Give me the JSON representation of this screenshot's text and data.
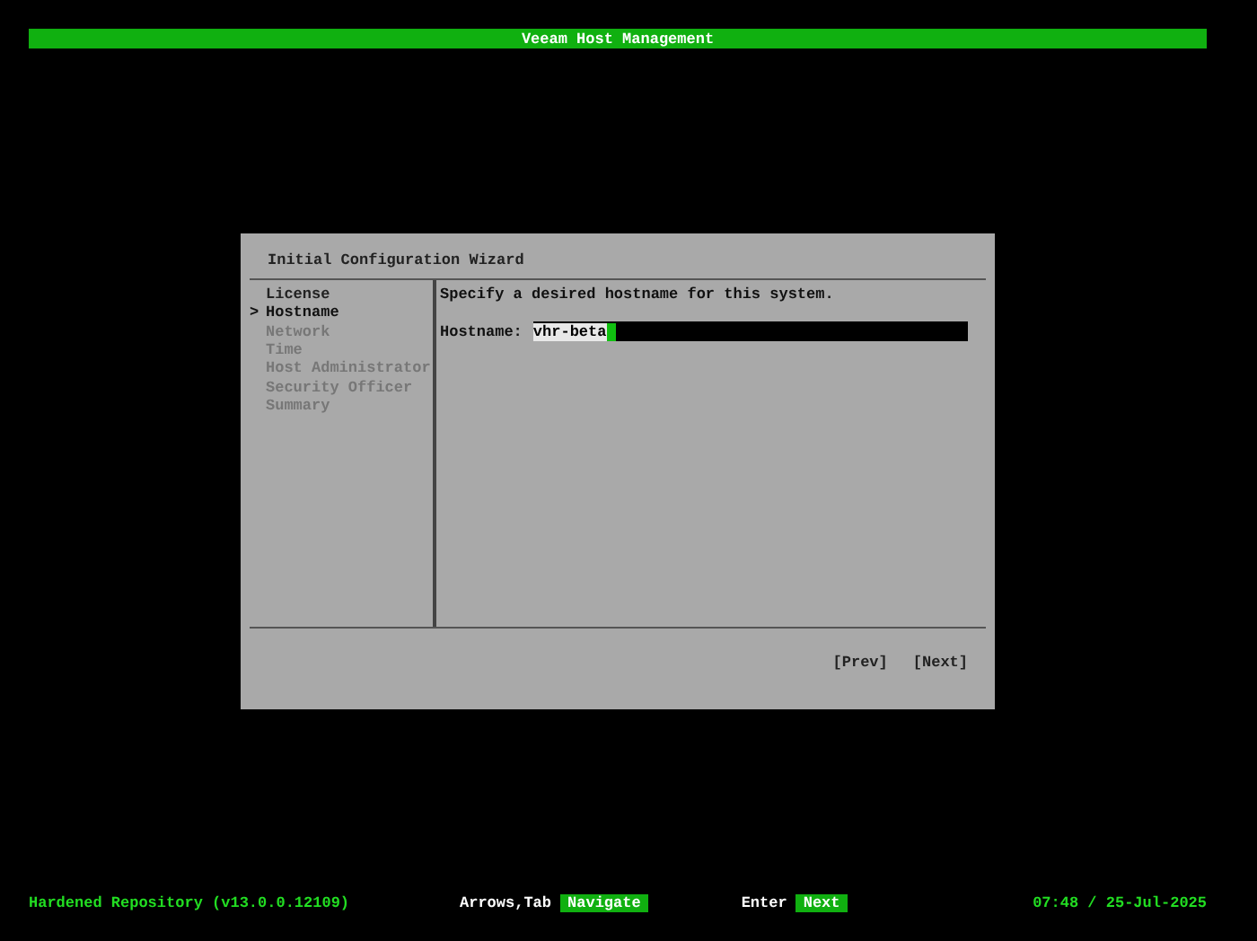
{
  "header": {
    "title": "Veeam Host Management"
  },
  "dialog": {
    "title": "Initial Configuration Wizard",
    "steps": [
      {
        "label": "License",
        "disabled": false,
        "selected": false
      },
      {
        "label": "Hostname",
        "disabled": false,
        "selected": true
      },
      {
        "label": "Network",
        "disabled": true,
        "selected": false
      },
      {
        "label": "Time",
        "disabled": true,
        "selected": false
      },
      {
        "label": "Host Administrator",
        "disabled": true,
        "selected": false
      },
      {
        "label": "Security Officer",
        "disabled": true,
        "selected": false
      },
      {
        "label": "Summary",
        "disabled": true,
        "selected": false
      }
    ],
    "selection_marker": ">",
    "instruction": "Specify a desired hostname for this system.",
    "field": {
      "label": "Hostname:",
      "value": "vhr-beta",
      "value_highlighted": true
    },
    "buttons": [
      "[Prev]",
      "[Next]"
    ]
  },
  "status_bar": {
    "product": "Hardened Repository (v13.0.0.12109)",
    "hints": [
      {
        "keys": "Arrows,Tab",
        "action": "Navigate"
      },
      {
        "keys": "Enter",
        "action": "Next"
      }
    ],
    "datetime": "07:48 / 25-Jul-2025"
  }
}
